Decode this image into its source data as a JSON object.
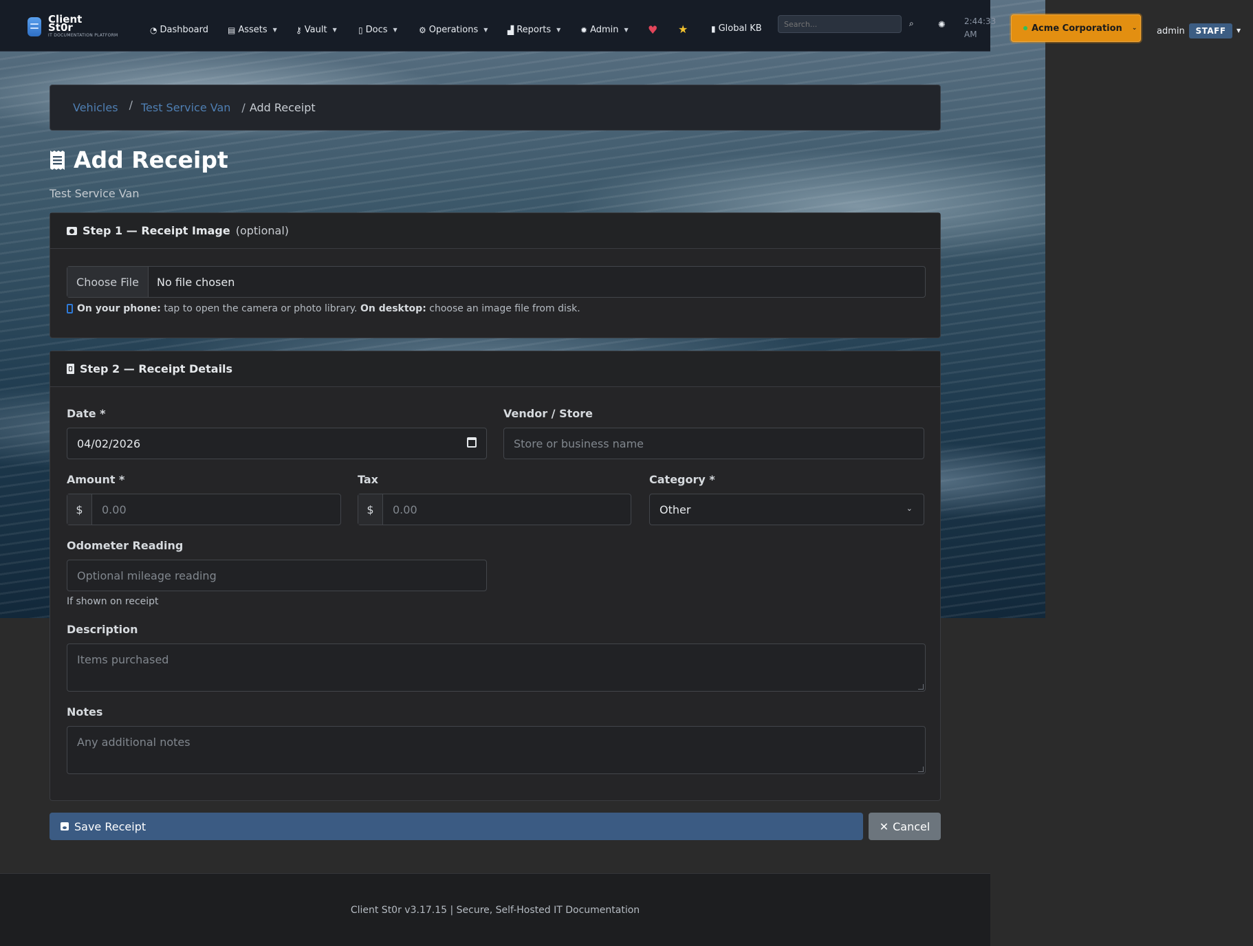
{
  "app": {
    "brand_name": "Client St0r",
    "brand_tagline": "IT DOCUMENTATION PLATFORM"
  },
  "nav": {
    "items": [
      {
        "label": "Dashboard",
        "icon": "dashboard-icon",
        "has_caret": false
      },
      {
        "label": "Assets",
        "icon": "box-icon",
        "has_caret": true
      },
      {
        "label": "Vault",
        "icon": "key-icon",
        "has_caret": true
      },
      {
        "label": "Docs",
        "icon": "file-icon",
        "has_caret": true
      },
      {
        "label": "Operations",
        "icon": "cogs-icon",
        "has_caret": true
      },
      {
        "label": "Reports",
        "icon": "chart-icon",
        "has_caret": true
      },
      {
        "label": "Admin",
        "icon": "gear-icon",
        "has_caret": true
      }
    ],
    "global_kb": "Global KB",
    "search_placeholder": "Search...",
    "clock": "2:44:33 AM",
    "organization": "Acme Corporation",
    "user": "admin",
    "role_badge": "STAFF",
    "colors": {
      "org_button": "#e38f11",
      "heart": "#e2455a",
      "star": "#f2c12e"
    }
  },
  "breadcrumb": {
    "items": [
      "Vehicles",
      "Test Service Van"
    ],
    "active": "Add Receipt"
  },
  "page": {
    "title": "Add Receipt",
    "subtitle": "Test Service Van"
  },
  "step1": {
    "title": "Step 1 — Receipt Image",
    "optional": "(optional)",
    "choose_file": "Choose File",
    "file_status": "No file chosen",
    "hint_phone_label": "On your phone:",
    "hint_phone_text": "tap to open the camera or photo library.",
    "hint_desktop_label": "On desktop:",
    "hint_desktop_text": "choose an image file from disk."
  },
  "step2": {
    "title": "Step 2 — Receipt Details",
    "date_label": "Date *",
    "date_value": "04/02/2026",
    "vendor_label": "Vendor / Store",
    "vendor_placeholder": "Store or business name",
    "amount_label": "Amount *",
    "amount_placeholder": "0.00",
    "tax_label": "Tax",
    "tax_placeholder": "0.00",
    "currency_symbol": "$",
    "category_label": "Category *",
    "category_value": "Other",
    "odometer_label": "Odometer Reading",
    "odometer_placeholder": "Optional mileage reading",
    "odometer_help": "If shown on receipt",
    "description_label": "Description",
    "description_placeholder": "Items purchased",
    "notes_label": "Notes",
    "notes_placeholder": "Any additional notes"
  },
  "actions": {
    "save": "Save Receipt",
    "cancel": "Cancel",
    "colors": {
      "save": "#3b5b83",
      "cancel": "#6c757d"
    }
  },
  "footer": {
    "text": "Client St0r v3.17.15 | Secure, Self-Hosted IT Documentation"
  }
}
